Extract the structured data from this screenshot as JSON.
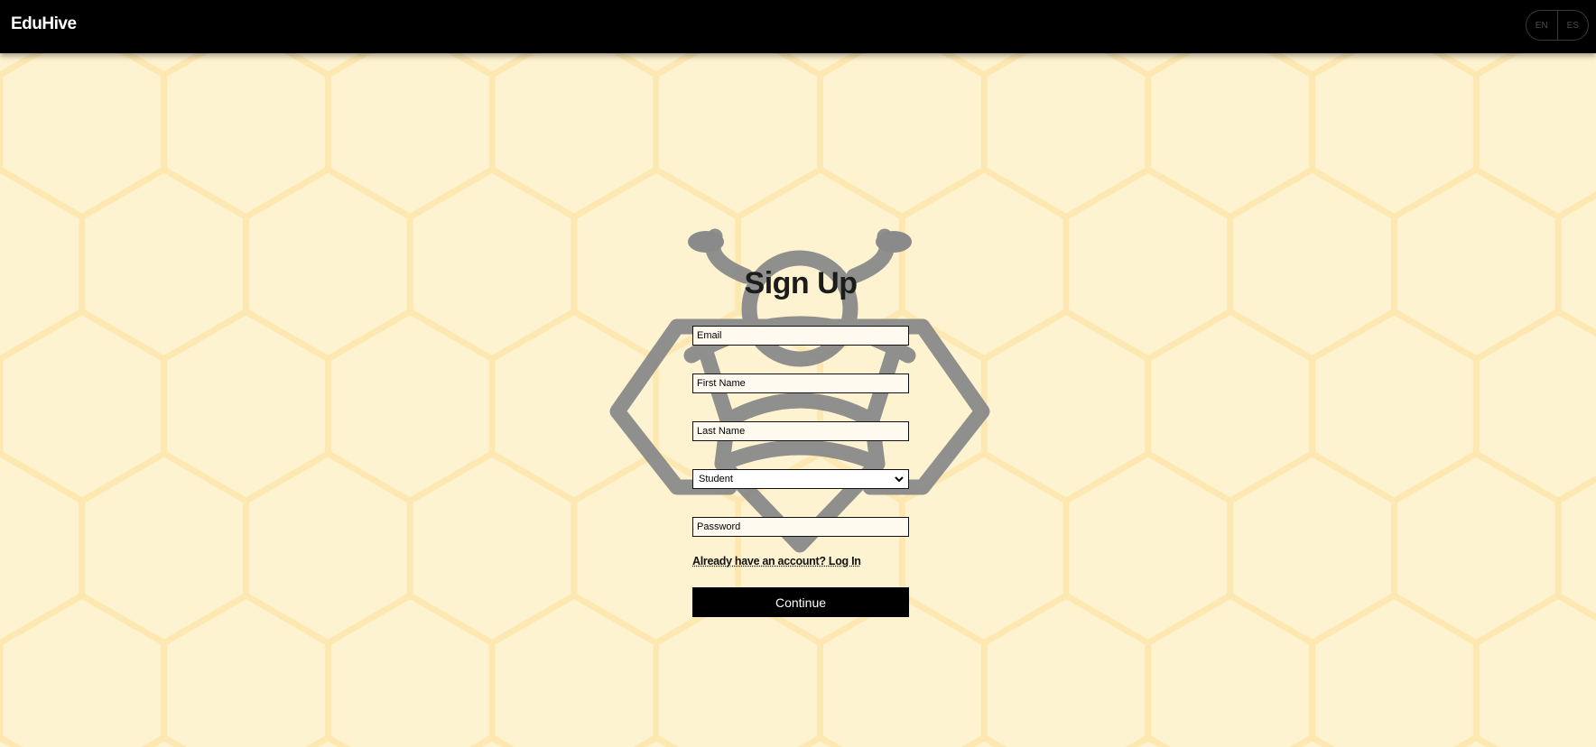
{
  "header": {
    "brand": "EduHive",
    "languages": [
      "EN",
      "ES"
    ]
  },
  "form": {
    "title": "Sign Up",
    "email_placeholder": "Email",
    "first_name_placeholder": "First Name",
    "last_name_placeholder": "Last Name",
    "role_selected": "Student",
    "password_placeholder": "Password",
    "login_link": "Already have an account? Log In",
    "submit_label": "Continue"
  },
  "icons": {
    "background": "honeycomb-pattern",
    "logo": "bee-icon",
    "select_arrow": "chevron-down-icon"
  },
  "colors": {
    "header_bg": "#000000",
    "page_bg": "#fef3d0",
    "honeycomb_lines": "#fde8b4",
    "logo": "#8a8a8a",
    "button_bg": "#000000"
  }
}
